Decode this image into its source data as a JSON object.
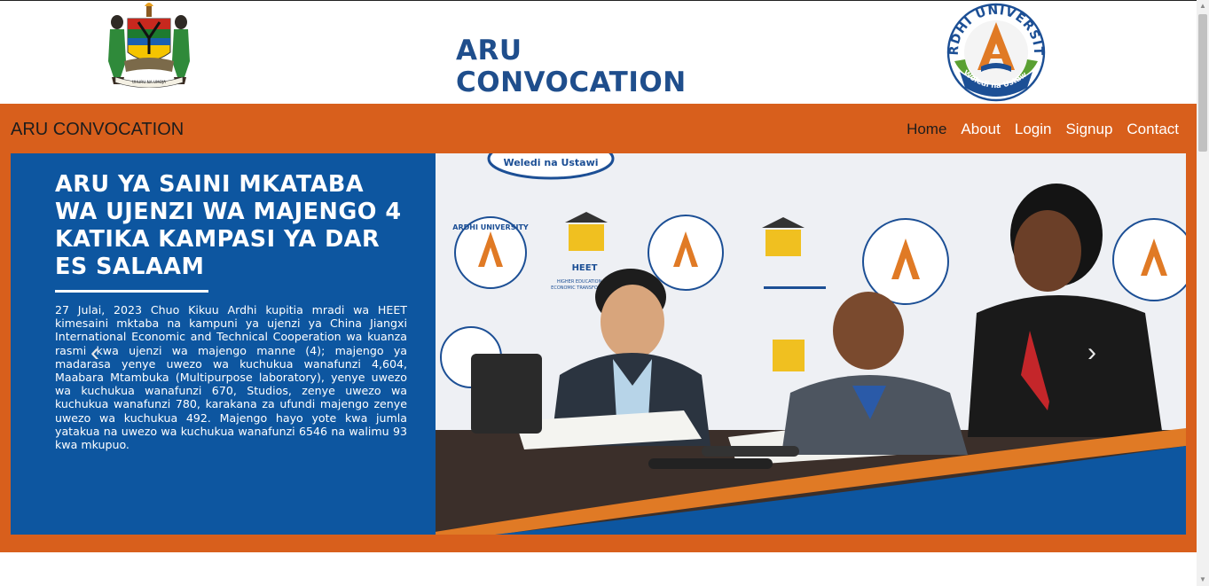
{
  "header": {
    "title": "ARU CONVOCATION",
    "coat_of_arms_motto": "UHURU NA UMOJA",
    "logo": {
      "arc_text": "ARDHI UNIVERSITY",
      "motto": "Weledi na Ustawi"
    }
  },
  "navbar": {
    "brand": "ARU CONVOCATION",
    "links": [
      {
        "label": "Home",
        "active": true
      },
      {
        "label": "About",
        "active": false
      },
      {
        "label": "Login",
        "active": false
      },
      {
        "label": "Signup",
        "active": false
      },
      {
        "label": "Contact",
        "active": false
      }
    ]
  },
  "slider": {
    "headline": "ARU YA SAINI MKATABA WA UJENZI WA MAJENGO 4 KATIKA KAMPASI YA DAR ES SALAAM",
    "body": "27 Julai, 2023 Chuo Kikuu Ardhi kupitia mradi wa HEET kimesaini mktaba na kampuni ya ujenzi ya China Jiangxi International Economic and Technical Cooperation wa kuanza rasmi kwa ujenzi wa majengo manne (4); majengo ya madarasa yenye uwezo wa kuchukua wanafunzi 4,604, Maabara Mtambuka (Multipurpose laboratory), yenye uwezo wa kuchukua wanafunzi 670, Studios, zenye uwezo wa kuchukua wanafunzi 780, karakana za ufundi majengo zenye uwezo wa kuchukua 492. Majengo hayo yote kwa jumla yatakua na uwezo wa kuchukua wanafunzi 6546 na walimu 93 kwa mkupuo.",
    "photo_banner": {
      "aru_text": "ARDHI UNIVERSITY",
      "aru_motto": "Weledi na Ustawi",
      "heet_text": "HEET",
      "heet_caption_1": "HIGHER EDUCATION FOR",
      "heet_caption_2": "ECONOMIC TRANSFORMATION"
    },
    "prev_icon": "chevron-left-icon",
    "next_icon": "chevron-right-icon"
  },
  "colors": {
    "navy": "#1f4e8c",
    "orange": "#d85f1c",
    "slide_blue": "#0d56a0"
  }
}
